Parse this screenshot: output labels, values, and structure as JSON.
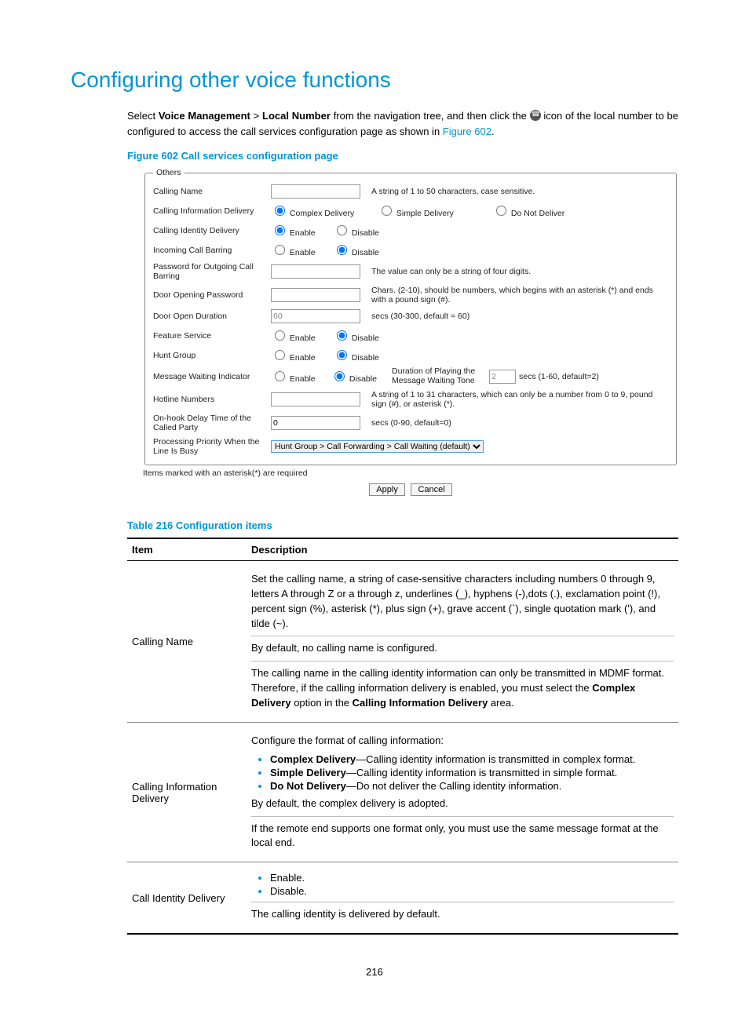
{
  "heading": "Configuring other voice functions",
  "intro": {
    "prefix": "Select ",
    "bold1": "Voice Management",
    "gt": " > ",
    "bold2": "Local Number",
    "mid": " from the navigation tree, and then click the ",
    "afterIcon": " icon of the local number to be configured to access the call services configuration page as shown in ",
    "figLink": "Figure 602",
    "end": "."
  },
  "figureCaption": "Figure 602 Call services configuration page",
  "legend": "Others",
  "rows": {
    "callingName": {
      "label": "Calling Name",
      "hint": "A string of 1 to 50 characters, case sensitive."
    },
    "cid": {
      "label": "Calling Information Delivery",
      "opt1": "Complex Delivery",
      "opt2": "Simple Delivery",
      "opt3": "Do Not Deliver"
    },
    "cidDelivery": {
      "label": "Calling Identity Delivery",
      "enable": "Enable",
      "disable": "Disable"
    },
    "icb": {
      "label": "Incoming Call Barring",
      "enable": "Enable",
      "disable": "Disable"
    },
    "pwdOut": {
      "label": "Password for Outgoing Call Barring",
      "hint": "The value can only be a string of four digits."
    },
    "doorPwd": {
      "label": "Door Opening Password",
      "hint": "Chars. (2-10), should be numbers, which begins with an asterisk (*) and ends with a pound sign (#)."
    },
    "doorDur": {
      "label": "Door Open Duration",
      "value": "60",
      "hint": "secs (30-300, default = 60)"
    },
    "feature": {
      "label": "Feature Service",
      "enable": "Enable",
      "disable": "Disable"
    },
    "hunt": {
      "label": "Hunt Group",
      "enable": "Enable",
      "disable": "Disable"
    },
    "mwi": {
      "label": "Message Waiting Indicator",
      "enable": "Enable",
      "disable": "Disable",
      "durLabel": "Duration of Playing the Message Waiting Tone",
      "durVal": "2",
      "durHint": "secs (1-60, default=2)"
    },
    "hotline": {
      "label": "Hotline Numbers",
      "hint": "A string of 1 to 31 characters, which can only be a number from 0 to 9, pound sign (#), or asterisk (*)."
    },
    "onhook": {
      "label": "On-hook Delay Time of the Called Party",
      "value": "0",
      "hint": "secs (0-90, default=0)"
    },
    "priority": {
      "label": "Processing Priority When the Line Is Busy",
      "select": "Hunt Group > Call Forwarding > Call Waiting (default) "
    }
  },
  "asteriskNote": "Items marked with an asterisk(*) are required",
  "buttons": {
    "apply": "Apply",
    "cancel": "Cancel"
  },
  "tableCaption": "Table 216 Configuration items",
  "tableHead": {
    "item": "Item",
    "desc": "Description"
  },
  "table": {
    "r1": {
      "item": "Calling Name",
      "p1a": "Set the calling name, a string of case-sensitive characters including numbers 0 through 9, letters A through Z or a through z, underlines (_), hyphens (-),dots (.), exclamation point (!), percent sign (%), asterisk (*), plus sign (+), grave accent (`), single quotation mark ('), and tilde (~).",
      "p2": "By default, no calling name is configured.",
      "p3a": "The calling name in the calling identity information can only be transmitted in MDMF format. Therefore, if the calling information delivery is enabled, you must select the ",
      "p3b": "Complex Delivery",
      "p3c": " option in the ",
      "p3d": "Calling Information Delivery",
      "p3e": " area."
    },
    "r2": {
      "item": "Calling Information Delivery",
      "intro": "Configure the format of calling information:",
      "b1a": "Complex Delivery",
      "b1b": "—Calling identity information is transmitted in complex format.",
      "b2a": "Simple Delivery",
      "b2b": "—Calling identity information is transmitted in simple format.",
      "b3a": "Do Not Delivery",
      "b3b": "—Do not deliver the Calling identity information.",
      "p2": "By default, the complex delivery is adopted.",
      "p3": "If the remote end supports one format only, you must use the same message format at the local end."
    },
    "r3": {
      "item": "Call Identity Delivery",
      "b1": "Enable.",
      "b2": "Disable.",
      "p": "The calling identity is delivered by default."
    }
  },
  "pageNumber": "216"
}
